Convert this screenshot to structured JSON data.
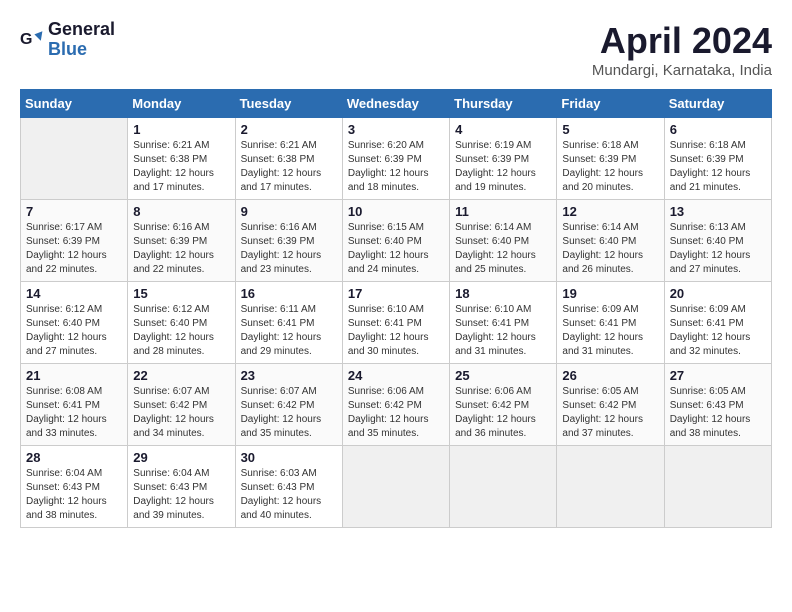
{
  "header": {
    "logo_line1": "General",
    "logo_line2": "Blue",
    "month_title": "April 2024",
    "location": "Mundargi, Karnataka, India"
  },
  "days_of_week": [
    "Sunday",
    "Monday",
    "Tuesday",
    "Wednesday",
    "Thursday",
    "Friday",
    "Saturday"
  ],
  "weeks": [
    [
      {
        "day": "",
        "empty": true
      },
      {
        "day": "1",
        "sunrise": "6:21 AM",
        "sunset": "6:38 PM",
        "daylight": "12 hours and 17 minutes."
      },
      {
        "day": "2",
        "sunrise": "6:21 AM",
        "sunset": "6:38 PM",
        "daylight": "12 hours and 17 minutes."
      },
      {
        "day": "3",
        "sunrise": "6:20 AM",
        "sunset": "6:39 PM",
        "daylight": "12 hours and 18 minutes."
      },
      {
        "day": "4",
        "sunrise": "6:19 AM",
        "sunset": "6:39 PM",
        "daylight": "12 hours and 19 minutes."
      },
      {
        "day": "5",
        "sunrise": "6:18 AM",
        "sunset": "6:39 PM",
        "daylight": "12 hours and 20 minutes."
      },
      {
        "day": "6",
        "sunrise": "6:18 AM",
        "sunset": "6:39 PM",
        "daylight": "12 hours and 21 minutes."
      }
    ],
    [
      {
        "day": "7",
        "sunrise": "6:17 AM",
        "sunset": "6:39 PM",
        "daylight": "12 hours and 22 minutes."
      },
      {
        "day": "8",
        "sunrise": "6:16 AM",
        "sunset": "6:39 PM",
        "daylight": "12 hours and 22 minutes."
      },
      {
        "day": "9",
        "sunrise": "6:16 AM",
        "sunset": "6:39 PM",
        "daylight": "12 hours and 23 minutes."
      },
      {
        "day": "10",
        "sunrise": "6:15 AM",
        "sunset": "6:40 PM",
        "daylight": "12 hours and 24 minutes."
      },
      {
        "day": "11",
        "sunrise": "6:14 AM",
        "sunset": "6:40 PM",
        "daylight": "12 hours and 25 minutes."
      },
      {
        "day": "12",
        "sunrise": "6:14 AM",
        "sunset": "6:40 PM",
        "daylight": "12 hours and 26 minutes."
      },
      {
        "day": "13",
        "sunrise": "6:13 AM",
        "sunset": "6:40 PM",
        "daylight": "12 hours and 27 minutes."
      }
    ],
    [
      {
        "day": "14",
        "sunrise": "6:12 AM",
        "sunset": "6:40 PM",
        "daylight": "12 hours and 27 minutes."
      },
      {
        "day": "15",
        "sunrise": "6:12 AM",
        "sunset": "6:40 PM",
        "daylight": "12 hours and 28 minutes."
      },
      {
        "day": "16",
        "sunrise": "6:11 AM",
        "sunset": "6:41 PM",
        "daylight": "12 hours and 29 minutes."
      },
      {
        "day": "17",
        "sunrise": "6:10 AM",
        "sunset": "6:41 PM",
        "daylight": "12 hours and 30 minutes."
      },
      {
        "day": "18",
        "sunrise": "6:10 AM",
        "sunset": "6:41 PM",
        "daylight": "12 hours and 31 minutes."
      },
      {
        "day": "19",
        "sunrise": "6:09 AM",
        "sunset": "6:41 PM",
        "daylight": "12 hours and 31 minutes."
      },
      {
        "day": "20",
        "sunrise": "6:09 AM",
        "sunset": "6:41 PM",
        "daylight": "12 hours and 32 minutes."
      }
    ],
    [
      {
        "day": "21",
        "sunrise": "6:08 AM",
        "sunset": "6:41 PM",
        "daylight": "12 hours and 33 minutes."
      },
      {
        "day": "22",
        "sunrise": "6:07 AM",
        "sunset": "6:42 PM",
        "daylight": "12 hours and 34 minutes."
      },
      {
        "day": "23",
        "sunrise": "6:07 AM",
        "sunset": "6:42 PM",
        "daylight": "12 hours and 35 minutes."
      },
      {
        "day": "24",
        "sunrise": "6:06 AM",
        "sunset": "6:42 PM",
        "daylight": "12 hours and 35 minutes."
      },
      {
        "day": "25",
        "sunrise": "6:06 AM",
        "sunset": "6:42 PM",
        "daylight": "12 hours and 36 minutes."
      },
      {
        "day": "26",
        "sunrise": "6:05 AM",
        "sunset": "6:42 PM",
        "daylight": "12 hours and 37 minutes."
      },
      {
        "day": "27",
        "sunrise": "6:05 AM",
        "sunset": "6:43 PM",
        "daylight": "12 hours and 38 minutes."
      }
    ],
    [
      {
        "day": "28",
        "sunrise": "6:04 AM",
        "sunset": "6:43 PM",
        "daylight": "12 hours and 38 minutes."
      },
      {
        "day": "29",
        "sunrise": "6:04 AM",
        "sunset": "6:43 PM",
        "daylight": "12 hours and 39 minutes."
      },
      {
        "day": "30",
        "sunrise": "6:03 AM",
        "sunset": "6:43 PM",
        "daylight": "12 hours and 40 minutes."
      },
      {
        "day": "",
        "empty": true
      },
      {
        "day": "",
        "empty": true
      },
      {
        "day": "",
        "empty": true
      },
      {
        "day": "",
        "empty": true
      }
    ]
  ]
}
